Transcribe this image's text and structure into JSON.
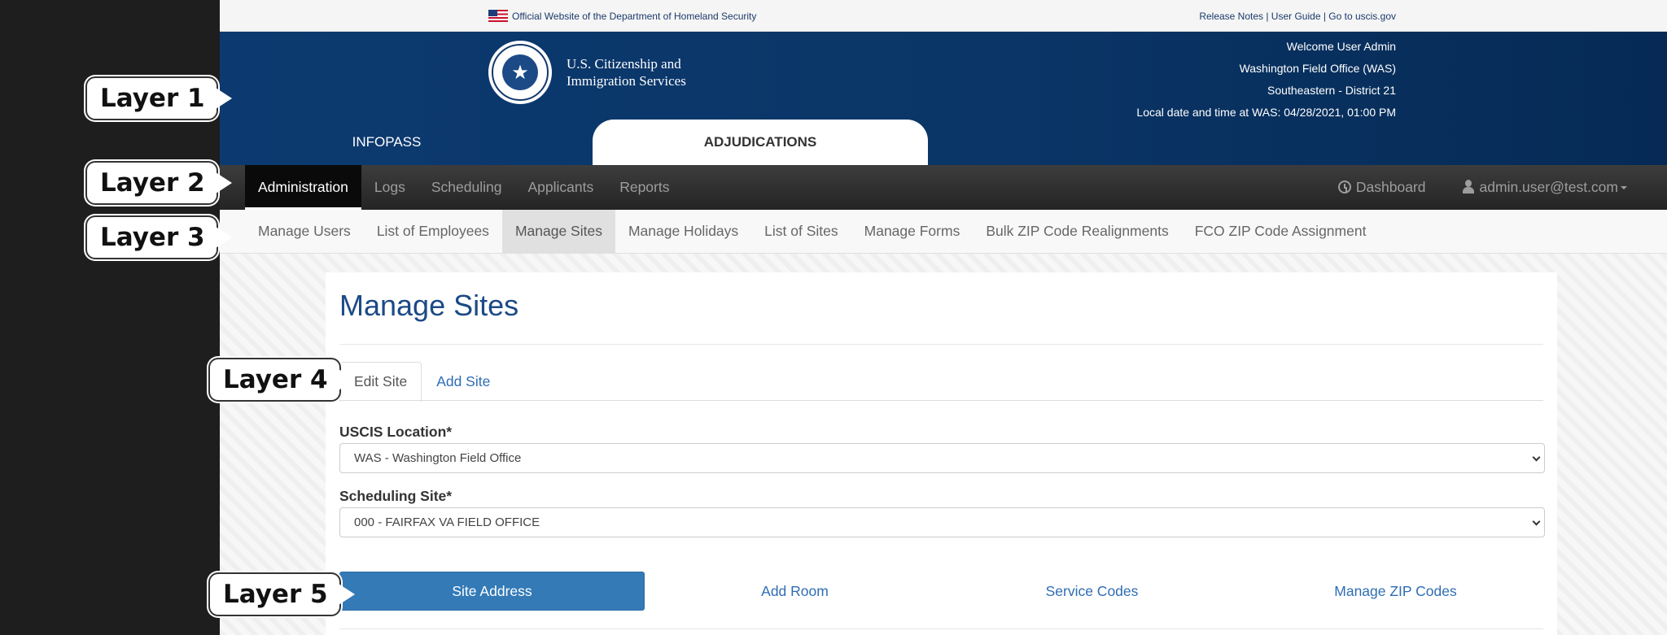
{
  "callouts": [
    "Layer 1",
    "Layer 2",
    "Layer 3",
    "Layer 4",
    "Layer 5"
  ],
  "topbar": {
    "official": "Official Website of the Department of Homeland Security",
    "links": "Release Notes | User Guide | Go to uscis.gov"
  },
  "header": {
    "agency_line1": "U.S. Citizenship and",
    "agency_line2": "Immigration Services",
    "welcome": "Welcome User Admin",
    "office": "Washington Field Office (WAS)",
    "district": "Southeastern - District 21",
    "datetime": "Local date and time at WAS: 04/28/2021, 01:00 PM",
    "tabs": [
      "INFOPASS",
      "ADJUDICATIONS"
    ]
  },
  "nav": {
    "items": [
      "Administration",
      "Logs",
      "Scheduling",
      "Applicants",
      "Reports"
    ],
    "dashboard": "Dashboard",
    "user": "admin.user@test.com"
  },
  "subnav": {
    "items": [
      "Manage Users",
      "List of Employees",
      "Manage Sites",
      "Manage Holidays",
      "List of Sites",
      "Manage Forms",
      "Bulk ZIP Code Realignments",
      "FCO ZIP Code Assignment"
    ]
  },
  "main": {
    "title": "Manage Sites",
    "tabs": [
      "Edit Site",
      "Add Site"
    ],
    "location_label": "USCIS Location*",
    "location_value": "WAS - Washington Field Office",
    "site_label": "Scheduling Site*",
    "site_value": "000 - FAIRFAX VA FIELD OFFICE",
    "actions": [
      "Site Address",
      "Add Room",
      "Service Codes",
      "Manage ZIP Codes"
    ]
  },
  "colors": {
    "brand_navy": "#0c3a70",
    "primary": "#337ab7",
    "link": "#2f6db3"
  }
}
